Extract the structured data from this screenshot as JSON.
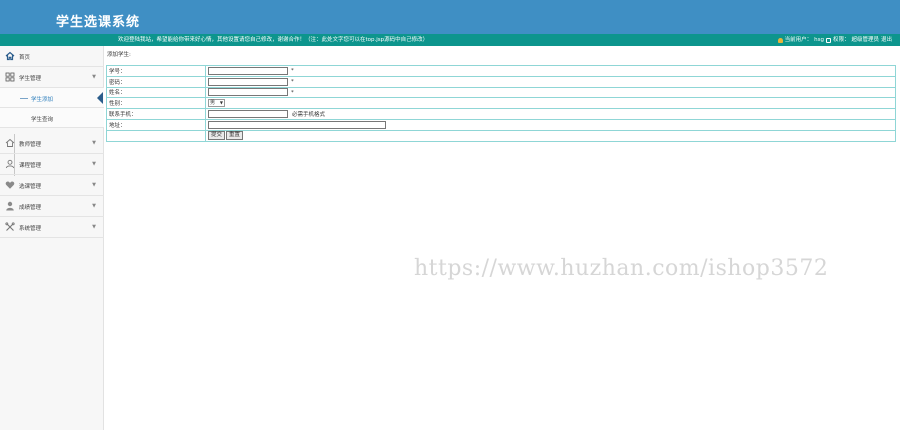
{
  "header": {
    "title": "学生选课系统",
    "welcome": "欢迎登陆我站，希望能给你带来好心情，其他设置请您自己修改，谢谢合作！（注：此处文字您可以在top.jsp源码中自己修改）",
    "current_user_label": "当前用户：",
    "current_user": "hsg",
    "role_label": "权限：",
    "role": "超级管理员",
    "logout": "退出"
  },
  "sidebar": {
    "home": "首页",
    "student_mgmt": "学生管理",
    "student_add": "学生添加",
    "student_query": "学生查询",
    "teacher_mgmt": "教师管理",
    "course_mgmt": "课程管理",
    "selection_mgmt": "选课管理",
    "grade_mgmt": "成绩管理",
    "system_mgmt": "系统管理"
  },
  "form": {
    "breadcrumb": "添加学生:",
    "student_id_label": "学号：",
    "password_label": "密码：",
    "name_label": "姓名：",
    "gender_label": "性别：",
    "gender_value": "男",
    "phone_label": "联系手机：",
    "phone_hint": "必需手机格式",
    "address_label": "地址：",
    "required_mark": "*",
    "submit": "提交",
    "reset": "重置"
  },
  "watermark": "https://www.huzhan.com/ishop3572",
  "colors": {
    "header_bg": "#3f8fc4",
    "infobar_bg": "#0d958d",
    "table_border": "#8fd6d6",
    "active_marker": "#2b5d8c"
  }
}
